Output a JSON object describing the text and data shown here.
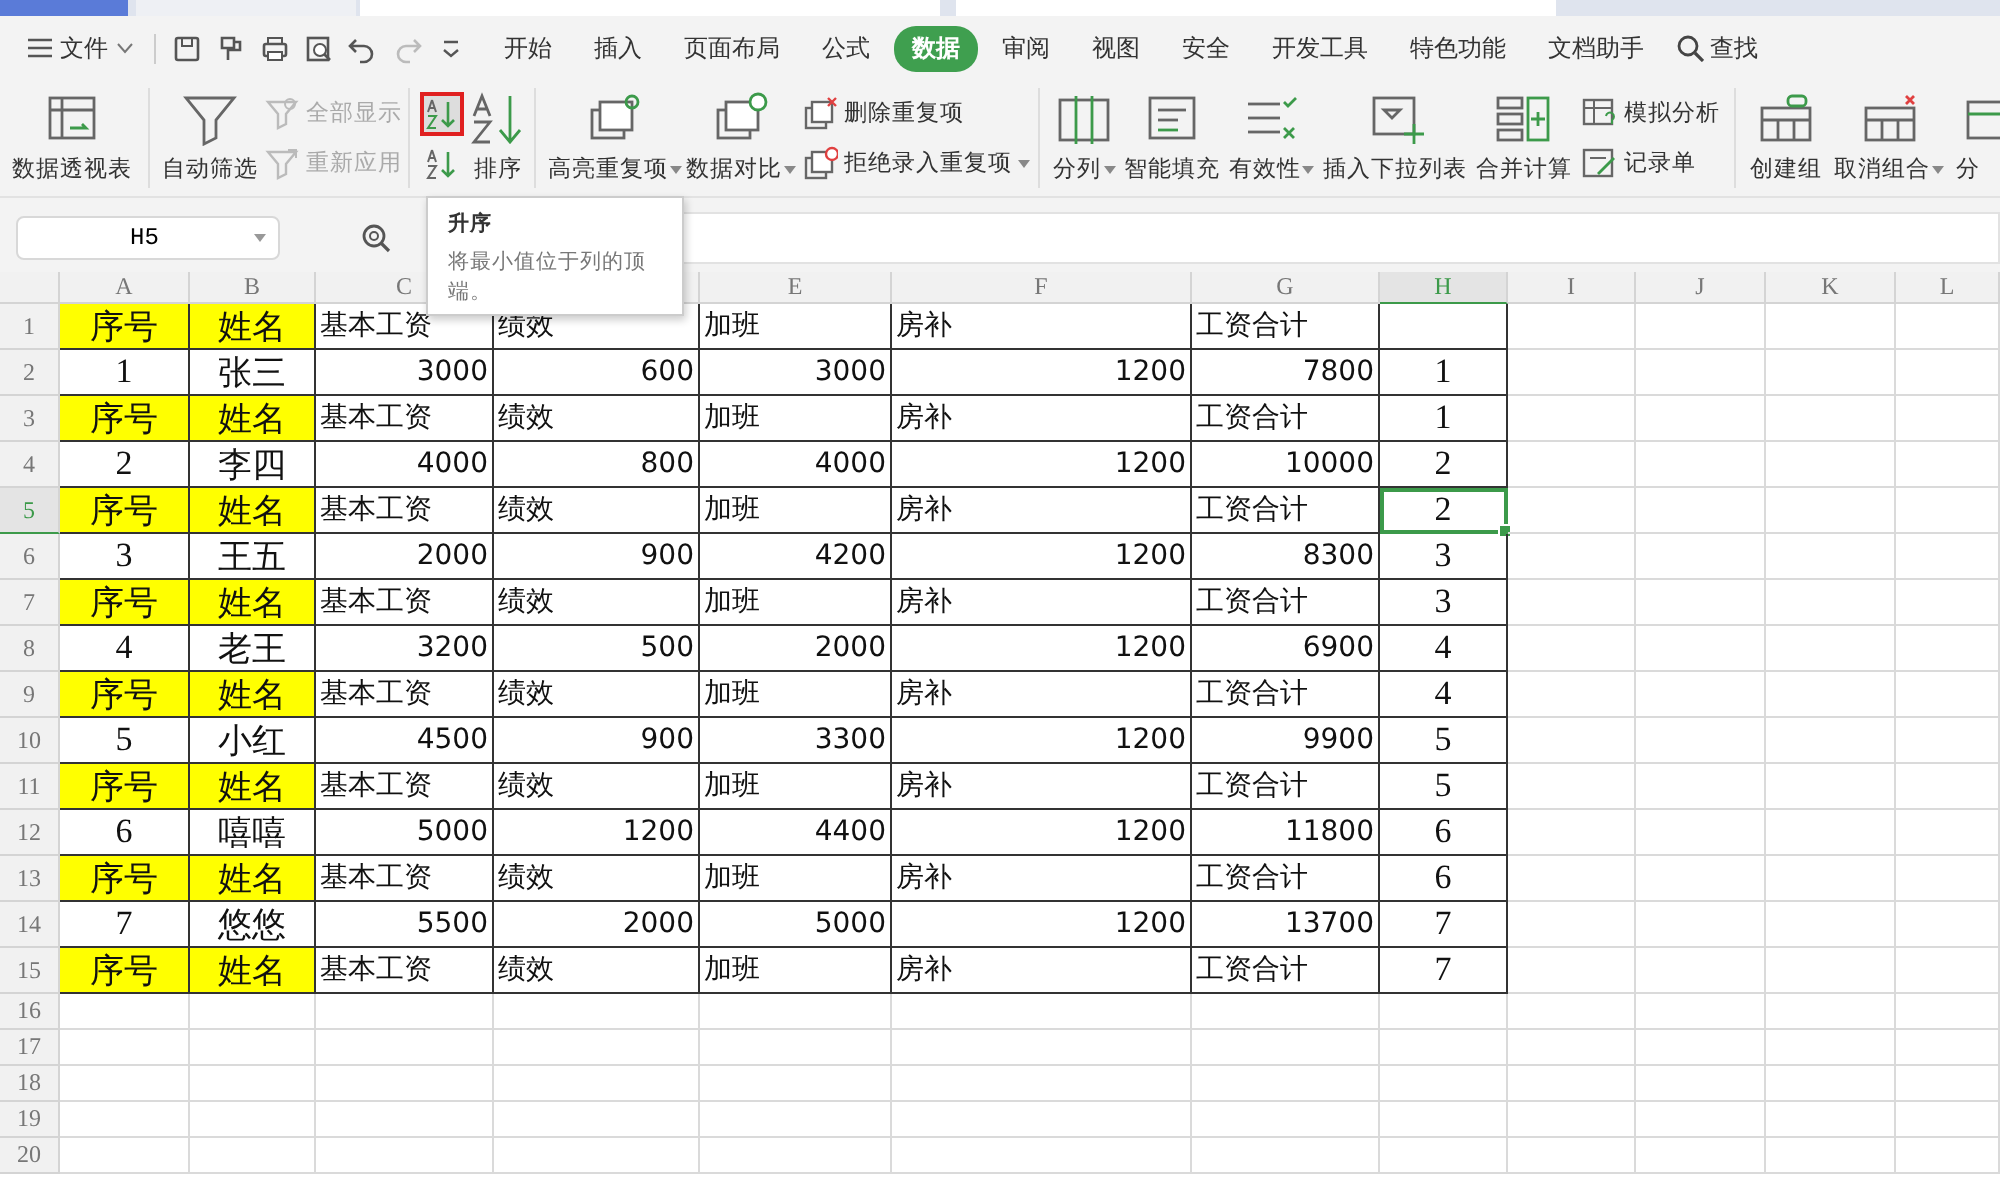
{
  "menu": {
    "file_label": "文件",
    "tabs": [
      {
        "label": "开始",
        "selected": false
      },
      {
        "label": "插入",
        "selected": false
      },
      {
        "label": "页面布局",
        "selected": false
      },
      {
        "label": "公式",
        "selected": false
      },
      {
        "label": "数据",
        "selected": true
      },
      {
        "label": "审阅",
        "selected": false
      },
      {
        "label": "视图",
        "selected": false
      },
      {
        "label": "安全",
        "selected": false
      },
      {
        "label": "开发工具",
        "selected": false
      },
      {
        "label": "特色功能",
        "selected": false
      },
      {
        "label": "文档助手",
        "selected": false
      }
    ],
    "search_label": "查找"
  },
  "ribbon": [
    {
      "items": [
        {
          "kind": "large",
          "label": "数据透视表",
          "dropdown": false
        }
      ]
    },
    {
      "items": [
        {
          "kind": "large",
          "label": "自动筛选",
          "dropdown": false
        },
        {
          "kind": "small",
          "label": "全部显示",
          "disabled": true
        },
        {
          "kind": "small",
          "label": "重新应用",
          "disabled": true
        }
      ]
    },
    {
      "items": [
        {
          "kind": "sorticon",
          "selected": true
        },
        {
          "kind": "sorticon",
          "selected": false
        },
        {
          "kind": "large",
          "label": "排序",
          "dropdown": false
        }
      ]
    },
    {
      "items": [
        {
          "kind": "large",
          "label": "高亮重复项",
          "dropdown": true
        },
        {
          "kind": "large",
          "label": "数据对比",
          "dropdown": true
        },
        {
          "kind": "small",
          "label": "删除重复项",
          "disabled": false
        },
        {
          "kind": "small",
          "label": "拒绝录入重复项",
          "disabled": false,
          "dropdown": true
        }
      ]
    },
    {
      "items": [
        {
          "kind": "large",
          "label": "分列",
          "dropdown": true
        },
        {
          "kind": "large",
          "label": "智能填充",
          "dropdown": false
        },
        {
          "kind": "large",
          "label": "有效性",
          "dropdown": true
        },
        {
          "kind": "large",
          "label": "插入下拉列表",
          "dropdown": false
        },
        {
          "kind": "large",
          "label": "合并计算",
          "dropdown": false
        },
        {
          "kind": "small",
          "label": "模拟分析",
          "disabled": false
        },
        {
          "kind": "small",
          "label": "记录单",
          "disabled": false
        }
      ]
    },
    {
      "items": [
        {
          "kind": "large",
          "label": "创建组",
          "dropdown": false
        },
        {
          "kind": "large",
          "label": "取消组合",
          "dropdown": true
        },
        {
          "kind": "large",
          "label": "分",
          "dropdown": false
        }
      ]
    }
  ],
  "tooltip": {
    "title": "升序",
    "description": "将最小值位于列的顶端。"
  },
  "name_box": "H5",
  "columns": [
    {
      "label": "A",
      "selected": false
    },
    {
      "label": "B",
      "selected": false
    },
    {
      "label": "C",
      "selected": false
    },
    {
      "selected": false
    },
    {
      "label": "E",
      "selected": false
    },
    {
      "label": "F",
      "selected": false
    },
    {
      "label": "G",
      "selected": false
    },
    {
      "label": "H",
      "selected": true
    },
    {
      "label": "I",
      "selected": false
    },
    {
      "label": "J",
      "selected": false
    },
    {
      "label": "K",
      "selected": false
    },
    {
      "label": "L",
      "selected": false
    }
  ],
  "rows": [
    {
      "number": "1",
      "kind": "header",
      "selected": false,
      "cells": [
        "序号",
        "姓名",
        "基本工资",
        "绩效",
        "加班",
        "房补",
        "工资合计",
        null
      ]
    },
    {
      "number": "2",
      "kind": "data",
      "selected": false,
      "cells": [
        "1",
        "张三",
        "3000",
        "600",
        "3000",
        "1200",
        "7800",
        "1"
      ]
    },
    {
      "number": "3",
      "kind": "header",
      "selected": false,
      "cells": [
        "序号",
        "姓名",
        "基本工资",
        "绩效",
        "加班",
        "房补",
        "工资合计",
        "1"
      ]
    },
    {
      "number": "4",
      "kind": "data",
      "selected": false,
      "cells": [
        "2",
        "李四",
        "4000",
        "800",
        "4000",
        "1200",
        "10000",
        "2"
      ]
    },
    {
      "number": "5",
      "kind": "header",
      "selected": true,
      "cells": [
        "序号",
        "姓名",
        "基本工资",
        "绩效",
        "加班",
        "房补",
        "工资合计",
        "2"
      ]
    },
    {
      "number": "6",
      "kind": "data",
      "selected": false,
      "cells": [
        "3",
        "王五",
        "2000",
        "900",
        "4200",
        "1200",
        "8300",
        "3"
      ]
    },
    {
      "number": "7",
      "kind": "header",
      "selected": false,
      "cells": [
        "序号",
        "姓名",
        "基本工资",
        "绩效",
        "加班",
        "房补",
        "工资合计",
        "3"
      ]
    },
    {
      "number": "8",
      "kind": "data",
      "selected": false,
      "cells": [
        "4",
        "老王",
        "3200",
        "500",
        "2000",
        "1200",
        "6900",
        "4"
      ]
    },
    {
      "number": "9",
      "kind": "header",
      "selected": false,
      "cells": [
        "序号",
        "姓名",
        "基本工资",
        "绩效",
        "加班",
        "房补",
        "工资合计",
        "4"
      ]
    },
    {
      "number": "10",
      "kind": "data",
      "selected": false,
      "cells": [
        "5",
        "小红",
        "4500",
        "900",
        "3300",
        "1200",
        "9900",
        "5"
      ]
    },
    {
      "number": "11",
      "kind": "header",
      "selected": false,
      "cells": [
        "序号",
        "姓名",
        "基本工资",
        "绩效",
        "加班",
        "房补",
        "工资合计",
        "5"
      ]
    },
    {
      "number": "12",
      "kind": "data",
      "selected": false,
      "cells": [
        "6",
        "嘻嘻",
        "5000",
        "1200",
        "4400",
        "1200",
        "11800",
        "6"
      ]
    },
    {
      "number": "13",
      "kind": "header",
      "selected": false,
      "cells": [
        "序号",
        "姓名",
        "基本工资",
        "绩效",
        "加班",
        "房补",
        "工资合计",
        "6"
      ]
    },
    {
      "number": "14",
      "kind": "data",
      "selected": false,
      "cells": [
        "7",
        "悠悠",
        "5500",
        "2000",
        "5000",
        "1200",
        "13700",
        "7"
      ]
    },
    {
      "number": "15",
      "kind": "header",
      "selected": false,
      "cells": [
        "序号",
        "姓名",
        "基本工资",
        "绩效",
        "加班",
        "房补",
        "工资合计",
        "7"
      ]
    },
    {
      "number": "16",
      "kind": "empty",
      "selected": false
    },
    {
      "number": "17",
      "kind": "empty",
      "selected": false
    },
    {
      "number": "18",
      "kind": "empty",
      "selected": false
    },
    {
      "number": "19",
      "kind": "empty",
      "selected": false
    },
    {
      "number": "20",
      "kind": "empty",
      "selected": false
    }
  ]
}
